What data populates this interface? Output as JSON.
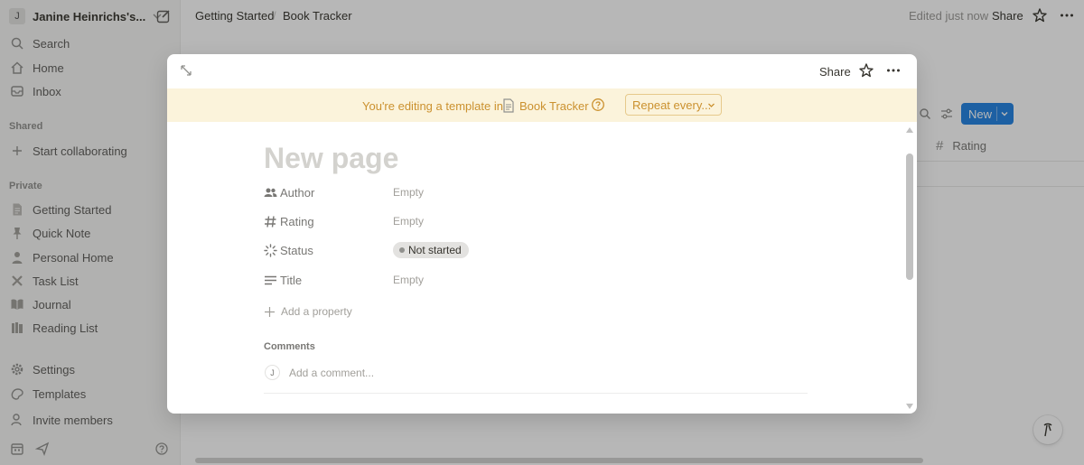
{
  "sidebar": {
    "workspace": {
      "avatar": "J",
      "name": "Janine Heinrichs's..."
    },
    "top_items": [
      {
        "label": "Search",
        "icon": "search-icon"
      },
      {
        "label": "Home",
        "icon": "home-icon"
      },
      {
        "label": "Inbox",
        "icon": "inbox-icon"
      }
    ],
    "shared_heading": "Shared",
    "shared_items": [
      {
        "label": "Start collaborating",
        "icon": "plus-icon"
      }
    ],
    "private_heading": "Private",
    "private_items": [
      {
        "label": "Getting Started",
        "icon": "document-icon"
      },
      {
        "label": "Quick Note",
        "icon": "pin-icon"
      },
      {
        "label": "Personal Home",
        "icon": "person-icon"
      },
      {
        "label": "Task List",
        "icon": "tools-icon"
      },
      {
        "label": "Journal",
        "icon": "book-icon"
      },
      {
        "label": "Reading List",
        "icon": "books-icon"
      }
    ],
    "bottom_items": [
      {
        "label": "Settings",
        "icon": "gear-icon"
      },
      {
        "label": "Templates",
        "icon": "templates-icon"
      },
      {
        "label": "Invite members",
        "icon": "invite-icon"
      }
    ]
  },
  "topbar": {
    "breadcrumbs": [
      "Getting Started",
      "Book Tracker"
    ],
    "edited": "Edited just now",
    "share": "Share"
  },
  "background": {
    "new_button": "New",
    "column_rating": "Rating"
  },
  "modal": {
    "share": "Share",
    "banner": {
      "text": "You're editing a template in",
      "link": "Book Tracker",
      "repeat": "Repeat every..."
    },
    "title_placeholder": "New page",
    "properties": [
      {
        "name": "Author",
        "value": "Empty",
        "icon": "people-icon"
      },
      {
        "name": "Rating",
        "value": "Empty",
        "icon": "hash-icon"
      },
      {
        "name": "Status",
        "value": "Not started",
        "icon": "status-icon"
      },
      {
        "name": "Title",
        "value": "Empty",
        "icon": "text-lines-icon"
      }
    ],
    "add_property": "Add a property",
    "comments_heading": "Comments",
    "comment_avatar": "J",
    "comment_placeholder": "Add a comment..."
  },
  "colors": {
    "accent": "#2383e2",
    "banner_bg": "#fbf3db",
    "banner_text": "#cb912f",
    "sidebar_bg": "#f7f7f5"
  }
}
